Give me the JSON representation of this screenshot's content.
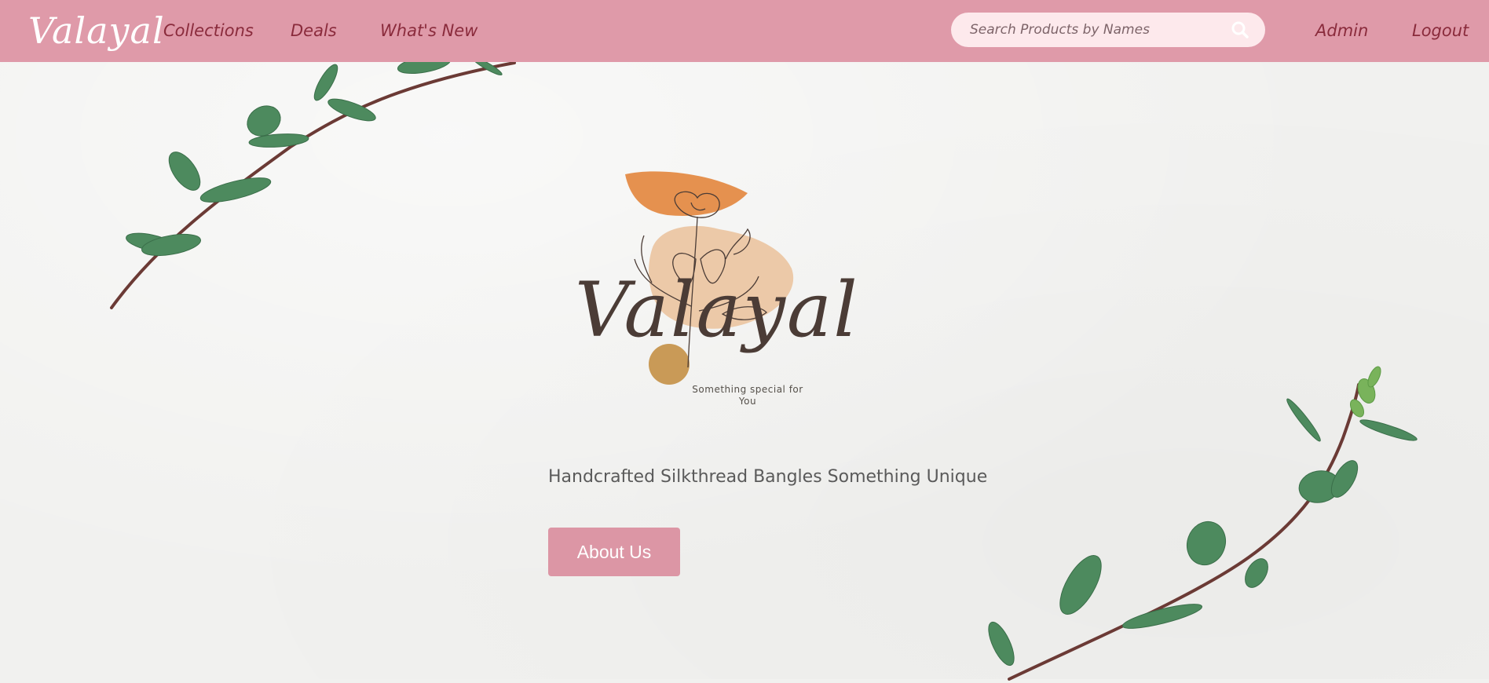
{
  "navbar": {
    "brand": "Valayal",
    "links": [
      "Collections",
      "Deals",
      "What's New"
    ],
    "search": {
      "placeholder": "Search Products by Names",
      "icon": "search-icon"
    },
    "admin_label": "Admin",
    "logout_label": "Logout"
  },
  "hero": {
    "logo_text": "Valayal",
    "logo_tagline": "Something special for You",
    "headline": "Handcrafted Silkthread Bangles Something Unique",
    "button_label": "About Us"
  },
  "colors": {
    "navbar": "#df9aa9",
    "nav_text": "#8a2b3c",
    "search_bg": "#fde9ec",
    "button": "#dc96a5",
    "page_bg": "#f1f1ef",
    "logo_orange": "#e5914f",
    "logo_peach": "#ecc9a8",
    "logo_gold": "#c99a57",
    "leaf_green": "#4d8a5e"
  }
}
